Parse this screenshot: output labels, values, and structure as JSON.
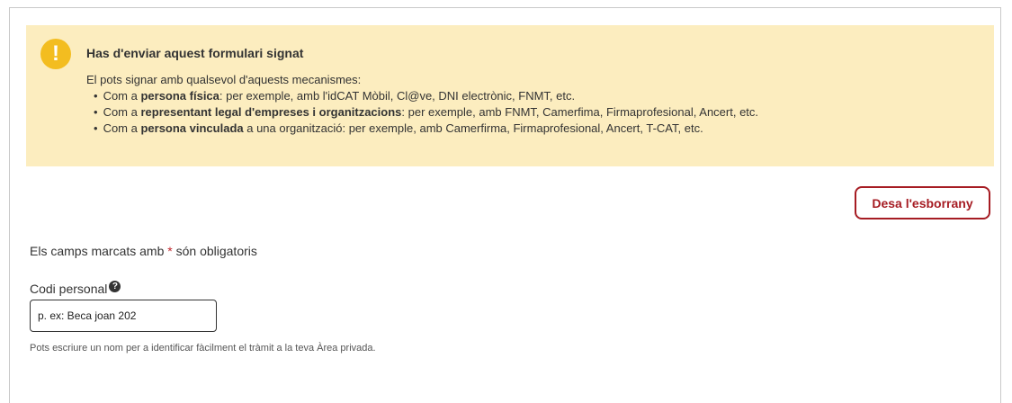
{
  "alert": {
    "icon": "!",
    "title": "Has d'enviar aquest formulari signat",
    "intro": "El pots signar amb qualsevol d'aquests mecanismes:",
    "items": [
      {
        "prefix": "Com a ",
        "bold": "persona física",
        "suffix": ": per exemple, amb l'idCAT Mòbil, Cl@ve, DNI electrònic, FNMT, etc."
      },
      {
        "prefix": "Com a ",
        "bold": "representant legal d'empreses i organitzacions",
        "suffix": ": per exemple, amb FNMT, Camerfima, Firmaprofesional, Ancert, etc."
      },
      {
        "prefix": "Com a ",
        "bold": "persona vinculada",
        "suffix": " a una organització: per exemple, amb Camerfirma, Firmaprofesional, Ancert, T-CAT, etc."
      }
    ]
  },
  "actions": {
    "save_draft_label": "Desa l'esborrany"
  },
  "form": {
    "required_note_prefix": "Els camps marcats amb ",
    "required_note_star": "*",
    "required_note_suffix": " són obligatoris",
    "personal_code": {
      "label": "Codi personal",
      "help_icon": "?",
      "placeholder": "p. ex: Beca joan 202",
      "hint": "Pots escriure un nom per a identificar fàcilment el tràmit a la teva Àrea privada."
    }
  },
  "colors": {
    "alert_bg": "#fcedbf",
    "alert_icon": "#f3bd20",
    "accent": "#a61c23"
  }
}
